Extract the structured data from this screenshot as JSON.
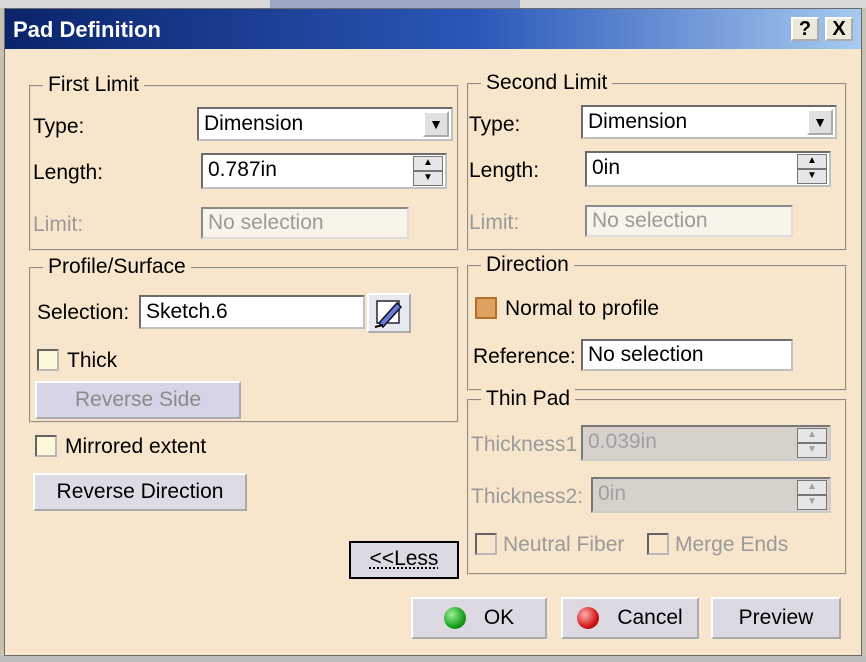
{
  "window": {
    "title": "Pad Definition",
    "help_label": "?",
    "close_label": "X"
  },
  "first_limit": {
    "label": "First Limit",
    "type_label": "Type:",
    "type_value": "Dimension",
    "length_label": "Length:",
    "length_value": "0.787in",
    "limit_label": "Limit:",
    "limit_value": "No selection"
  },
  "second_limit": {
    "label": "Second Limit",
    "type_label": "Type:",
    "type_value": "Dimension",
    "length_label": "Length:",
    "length_value": "0in",
    "limit_label": "Limit:",
    "limit_value": "No selection"
  },
  "profile": {
    "label": "Profile/Surface",
    "selection_label": "Selection:",
    "selection_value": "Sketch.6",
    "thick_label": "Thick",
    "reverse_side_label": "Reverse Side"
  },
  "direction": {
    "label": "Direction",
    "normal_label": "Normal to profile",
    "reference_label": "Reference:",
    "reference_value": "No selection"
  },
  "thin_pad": {
    "label": "Thin Pad",
    "thickness1_label": "Thickness1",
    "thickness1_value": "0.039in",
    "thickness2_label": "Thickness2:",
    "thickness2_value": "0in",
    "neutral_label": "Neutral Fiber",
    "merge_label": "Merge Ends"
  },
  "mirrored_label": "Mirrored extent",
  "reverse_direction_label": "Reverse Direction",
  "less_label": "<<Less",
  "buttons": {
    "ok": "OK",
    "cancel": "Cancel",
    "preview": "Preview"
  },
  "colors": {
    "ok_dot": "#1aa01a",
    "cancel_dot": "#d41818",
    "panel": "#f7e6cb"
  },
  "icons": {
    "sketch": "sketch-pencil-icon",
    "dropdown": "chevron-down-icon",
    "spinner": "spinner-icon"
  }
}
